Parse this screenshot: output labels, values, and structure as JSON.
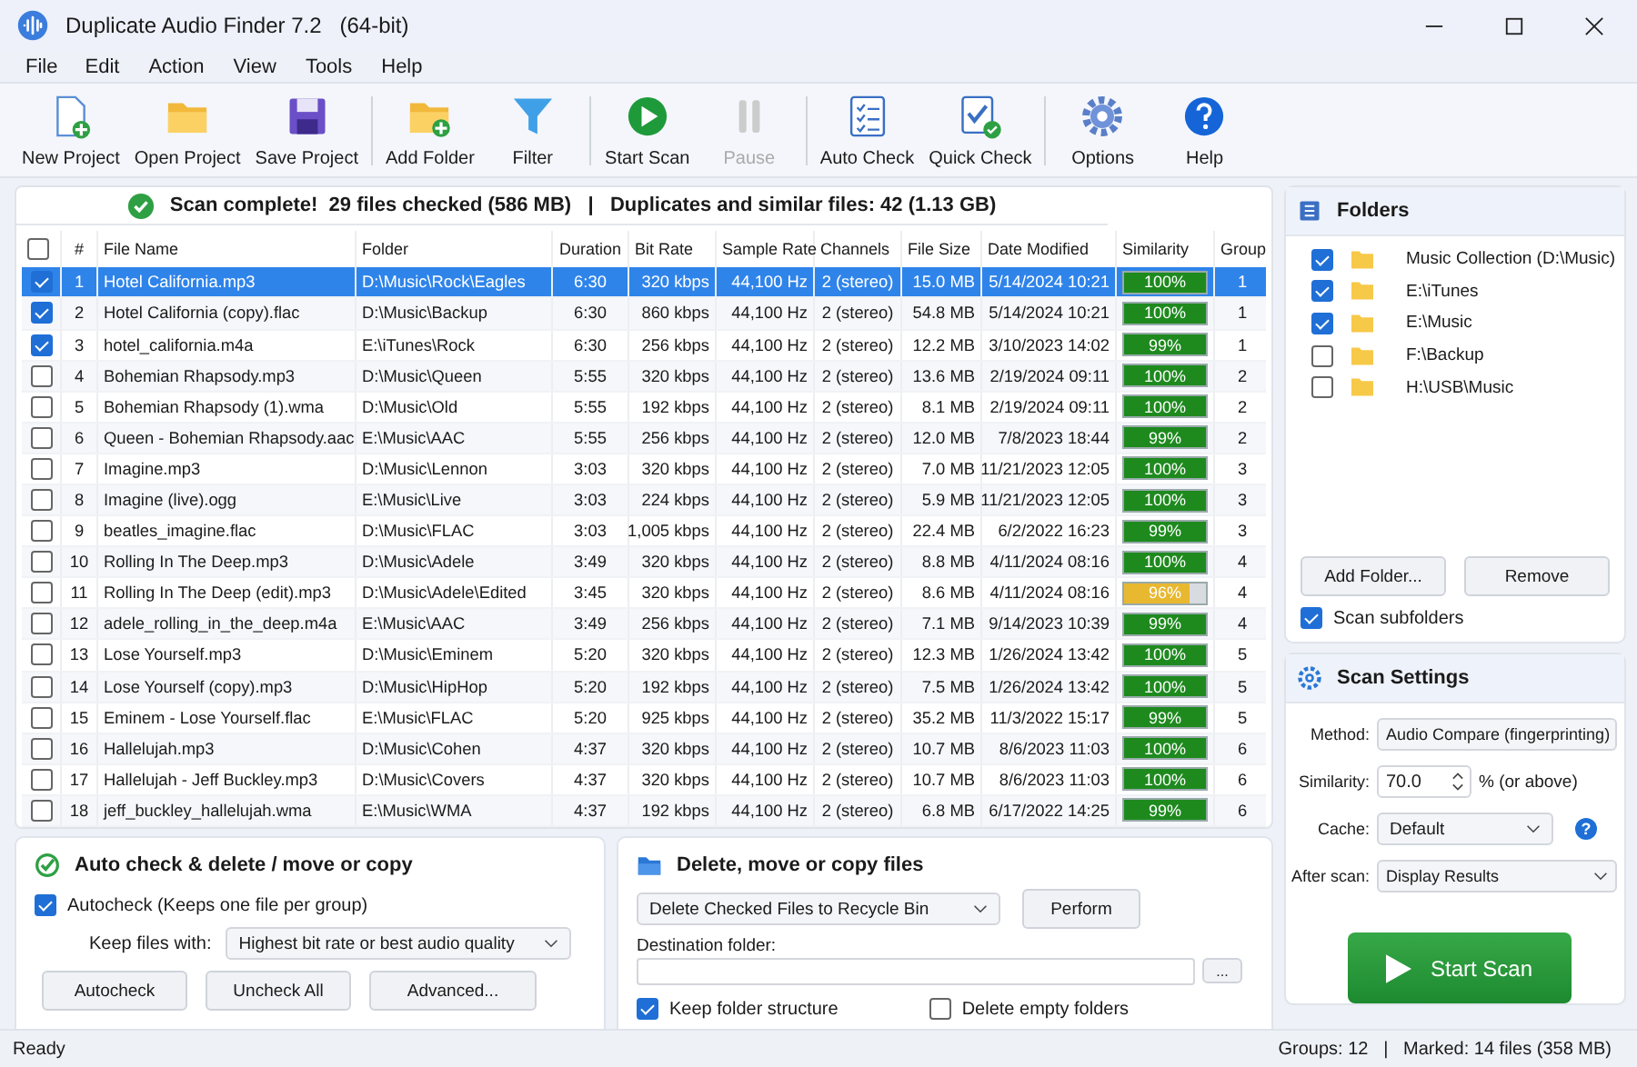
{
  "window": {
    "title": "Duplicate Audio Finder 7.2   (64-bit)"
  },
  "menu": [
    "File",
    "Edit",
    "Action",
    "View",
    "Tools",
    "Help"
  ],
  "toolbar": [
    {
      "items": [
        {
          "label": "New Project",
          "kind": "new",
          "disabled": false
        },
        {
          "label": "Open Project",
          "kind": "open",
          "disabled": false
        },
        {
          "label": "Save Project",
          "kind": "save",
          "disabled": false
        }
      ]
    },
    {
      "items": [
        {
          "label": "Add Folder",
          "kind": "addfolder",
          "disabled": false
        },
        {
          "label": "Filter",
          "kind": "filter",
          "disabled": false
        }
      ]
    },
    {
      "items": [
        {
          "label": "Start Scan",
          "kind": "play",
          "disabled": false
        },
        {
          "label": "Pause",
          "kind": "pause",
          "disabled": true
        }
      ]
    },
    {
      "items": [
        {
          "label": "Auto Check",
          "kind": "list",
          "disabled": false
        },
        {
          "label": "Quick Check",
          "kind": "quick",
          "disabled": false
        }
      ]
    },
    {
      "items": [
        {
          "label": "Options",
          "kind": "gear",
          "disabled": false
        },
        {
          "label": "Help",
          "kind": "help",
          "disabled": false
        }
      ]
    }
  ],
  "summary": "Scan complete!  29 files checked (586 MB)   |   Duplicates and similar files: 42 (1.13 GB)",
  "table": {
    "select_all_checked": false,
    "columns": [
      "#",
      "File Name",
      "Folder",
      "Duration",
      "Bit Rate",
      "Sample Rate",
      "Channels",
      "File Size",
      "Date Modified",
      "Similarity",
      "Group"
    ],
    "rows": [
      {
        "checked": true,
        "selected": true,
        "cells": [
          "1",
          "Hotel California.mp3",
          "D:\\Music\\Rock\\Eagles",
          "6:30",
          "320 kbps",
          "44,100 Hz",
          "2 (stereo)",
          "15.0 MB",
          "5/14/2024 10:21"
        ],
        "similarity": "100%",
        "level": 1,
        "color": "#1e8a1e",
        "group": "1"
      },
      {
        "checked": true,
        "selected": false,
        "cells": [
          "2",
          "Hotel California (copy).flac",
          "D:\\Music\\Backup",
          "6:30",
          "860 kbps",
          "44,100 Hz",
          "2 (stereo)",
          "54.8 MB",
          "5/14/2024 10:21"
        ],
        "similarity": "100%",
        "level": 1,
        "color": "#1e8a1e",
        "group": "1"
      },
      {
        "checked": true,
        "selected": false,
        "cells": [
          "3",
          "hotel_california.m4a",
          "E:\\iTunes\\Rock",
          "6:30",
          "256 kbps",
          "44,100 Hz",
          "2 (stereo)",
          "12.2 MB",
          "3/10/2023 14:02"
        ],
        "similarity": "99%",
        "level": 0.99,
        "color": "#1e8a1e",
        "group": "1"
      },
      {
        "checked": false,
        "selected": false,
        "cells": [
          "4",
          "Bohemian Rhapsody.mp3",
          "D:\\Music\\Queen",
          "5:55",
          "320 kbps",
          "44,100 Hz",
          "2 (stereo)",
          "13.6 MB",
          "2/19/2024 09:11"
        ],
        "similarity": "100%",
        "level": 1,
        "color": "#1e8a1e",
        "group": "2"
      },
      {
        "checked": false,
        "selected": false,
        "cells": [
          "5",
          "Bohemian Rhapsody (1).wma",
          "D:\\Music\\Old",
          "5:55",
          "192 kbps",
          "44,100 Hz",
          "2 (stereo)",
          "8.1 MB",
          "2/19/2024 09:11"
        ],
        "similarity": "100%",
        "level": 1,
        "color": "#1e8a1e",
        "group": "2"
      },
      {
        "checked": false,
        "selected": false,
        "cells": [
          "6",
          "Queen - Bohemian Rhapsody.aac",
          "E:\\Music\\AAC",
          "5:55",
          "256 kbps",
          "44,100 Hz",
          "2 (stereo)",
          "12.0 MB",
          "7/8/2023 18:44"
        ],
        "similarity": "99%",
        "level": 0.99,
        "color": "#1e8a1e",
        "group": "2"
      },
      {
        "checked": false,
        "selected": false,
        "cells": [
          "7",
          "Imagine.mp3",
          "D:\\Music\\Lennon",
          "3:03",
          "320 kbps",
          "44,100 Hz",
          "2 (stereo)",
          "7.0 MB",
          "11/21/2023 12:05"
        ],
        "similarity": "100%",
        "level": 1,
        "color": "#1e8a1e",
        "group": "3"
      },
      {
        "checked": false,
        "selected": false,
        "cells": [
          "8",
          "Imagine (live).ogg",
          "E:\\Music\\Live",
          "3:03",
          "224 kbps",
          "44,100 Hz",
          "2 (stereo)",
          "5.9 MB",
          "11/21/2023 12:05"
        ],
        "similarity": "100%",
        "level": 1,
        "color": "#1e8a1e",
        "group": "3"
      },
      {
        "checked": false,
        "selected": false,
        "cells": [
          "9",
          "beatles_imagine.flac",
          "D:\\Music\\FLAC",
          "3:03",
          "1,005 kbps",
          "44,100 Hz",
          "2 (stereo)",
          "22.4 MB",
          "6/2/2022 16:23"
        ],
        "similarity": "99%",
        "level": 0.99,
        "color": "#1e8a1e",
        "group": "3"
      },
      {
        "checked": false,
        "selected": false,
        "cells": [
          "10",
          "Rolling In The Deep.mp3",
          "D:\\Music\\Adele",
          "3:49",
          "320 kbps",
          "44,100 Hz",
          "2 (stereo)",
          "8.8 MB",
          "4/11/2024 08:16"
        ],
        "similarity": "100%",
        "level": 1,
        "color": "#1e8a1e",
        "group": "4"
      },
      {
        "checked": false,
        "selected": false,
        "cells": [
          "11",
          "Rolling In The Deep (edit).mp3",
          "D:\\Music\\Adele\\Edited",
          "3:45",
          "320 kbps",
          "44,100 Hz",
          "2 (stereo)",
          "8.6 MB",
          "4/11/2024 08:16"
        ],
        "similarity": "96%",
        "level": 0.8,
        "color": "#e8b830",
        "group": "4"
      },
      {
        "checked": false,
        "selected": false,
        "cells": [
          "12",
          "adele_rolling_in_the_deep.m4a",
          "E:\\Music\\AAC",
          "3:49",
          "256 kbps",
          "44,100 Hz",
          "2 (stereo)",
          "7.1 MB",
          "9/14/2023 10:39"
        ],
        "similarity": "99%",
        "level": 0.99,
        "color": "#1e8a1e",
        "group": "4"
      },
      {
        "checked": false,
        "selected": false,
        "cells": [
          "13",
          "Lose Yourself.mp3",
          "D:\\Music\\Eminem",
          "5:20",
          "320 kbps",
          "44,100 Hz",
          "2 (stereo)",
          "12.3 MB",
          "1/26/2024 13:42"
        ],
        "similarity": "100%",
        "level": 1,
        "color": "#1e8a1e",
        "group": "5"
      },
      {
        "checked": false,
        "selected": false,
        "cells": [
          "14",
          "Lose Yourself (copy).mp3",
          "D:\\Music\\HipHop",
          "5:20",
          "192 kbps",
          "44,100 Hz",
          "2 (stereo)",
          "7.5 MB",
          "1/26/2024 13:42"
        ],
        "similarity": "100%",
        "level": 1,
        "color": "#1e8a1e",
        "group": "5"
      },
      {
        "checked": false,
        "selected": false,
        "cells": [
          "15",
          "Eminem - Lose Yourself.flac",
          "E:\\Music\\FLAC",
          "5:20",
          "925 kbps",
          "44,100 Hz",
          "2 (stereo)",
          "35.2 MB",
          "11/3/2022 15:17"
        ],
        "similarity": "99%",
        "level": 0.99,
        "color": "#1e8a1e",
        "group": "5"
      },
      {
        "checked": false,
        "selected": false,
        "cells": [
          "16",
          "Hallelujah.mp3",
          "D:\\Music\\Cohen",
          "4:37",
          "320 kbps",
          "44,100 Hz",
          "2 (stereo)",
          "10.7 MB",
          "8/6/2023 11:03"
        ],
        "similarity": "100%",
        "level": 1,
        "color": "#1e8a1e",
        "group": "6"
      },
      {
        "checked": false,
        "selected": false,
        "cells": [
          "17",
          "Hallelujah - Jeff Buckley.mp3",
          "D:\\Music\\Covers",
          "4:37",
          "320 kbps",
          "44,100 Hz",
          "2 (stereo)",
          "10.7 MB",
          "8/6/2023 11:03"
        ],
        "similarity": "100%",
        "level": 1,
        "color": "#1e8a1e",
        "group": "6"
      },
      {
        "checked": false,
        "selected": false,
        "cells": [
          "18",
          "jeff_buckley_hallelujah.wma",
          "E:\\Music\\WMA",
          "4:37",
          "192 kbps",
          "44,100 Hz",
          "2 (stereo)",
          "6.8 MB",
          "6/17/2022 14:25"
        ],
        "similarity": "99%",
        "level": 0.99,
        "color": "#1e8a1e",
        "group": "6"
      }
    ]
  },
  "folders": {
    "title": "Folders",
    "items": [
      {
        "path": "Music Collection (D:\\Music)",
        "checked": true
      },
      {
        "path": "E:\\iTunes",
        "checked": true
      },
      {
        "path": "E:\\Music",
        "checked": true
      },
      {
        "path": "F:\\Backup",
        "checked": false
      },
      {
        "path": "H:\\USB\\Music",
        "checked": false
      }
    ],
    "buttons": [
      "Add Folder...",
      "Remove"
    ],
    "subfolders": {
      "label": "Scan subfolders",
      "checked": true
    }
  },
  "settings": {
    "title": "Scan Settings",
    "method_label": "Method:",
    "method": "Audio Compare (fingerprinting)",
    "similarity_label": "Similarity:",
    "similarity": "70.0",
    "similarity_unit": "% (or above)",
    "cache_label": "Cache:",
    "cache": "Default",
    "help": "?",
    "after_label": "After scan:",
    "after": "Display Results",
    "start": "Start Scan"
  },
  "autocheck": {
    "title": "Auto check & delete / move or copy",
    "autocheck": {
      "label": "Autocheck (Keeps one file per group)",
      "checked": true
    },
    "keep_label": "Keep files with:",
    "keep": "Highest bit rate or best audio quality",
    "buttons": [
      "Autocheck",
      "Uncheck All",
      "Advanced..."
    ]
  },
  "delete": {
    "title": "Delete, move or copy files",
    "action": "Delete Checked Files to Recycle Bin",
    "perform": "Perform",
    "dest_label": "Destination folder:",
    "browse": "...",
    "keep_structure": {
      "label": "Keep folder structure",
      "checked": true
    },
    "delete_empty": {
      "label": "Delete empty folders",
      "checked": false
    }
  },
  "status_bar": {
    "left": "Ready",
    "right": "Groups: 12   |   Marked: 14 files (358 MB)"
  }
}
